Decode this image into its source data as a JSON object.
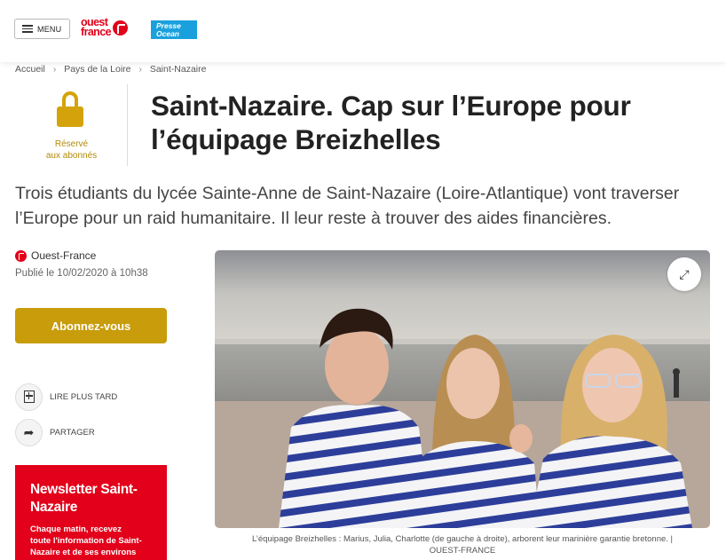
{
  "header": {
    "menu_label": "MENU",
    "brand_main_line1": "ouest",
    "brand_main_line2": "france",
    "brand_partner_line1": "Presse",
    "brand_partner_line2": "Ocean"
  },
  "breadcrumb": [
    "Accueil",
    "Pays de la Loire",
    "Saint-Nazaire"
  ],
  "reserved": {
    "line1": "Réservé",
    "line2": "aux abonnés"
  },
  "article": {
    "title_line1": "Saint-Nazaire. Cap sur l’Europe pour",
    "title_line2": "l’équipage Breizhelles",
    "lead": "Trois étudiants du lycée Sainte-Anne de Saint-Nazaire (Loire-Atlantique) vont traverser l’Europe pour un raid humanitaire. Il leur reste à trouver des aides financières.",
    "source": "Ouest-France",
    "published": "Publié le 10/02/2020 à 10h38",
    "caption_line1": "L’équipage Breizhelles : Marius, Julia, Charlotte (de gauche à droite), arborent leur marinière garantie bretonne. |",
    "caption_line2": "OUEST-FRANCE"
  },
  "actions": {
    "subscribe": "Abonnez-vous",
    "read_later": "LIRE PLUS TARD",
    "share": "PARTAGER"
  },
  "newsletter": {
    "title_line1": "Newsletter Saint-",
    "title_line2": "Nazaire",
    "text_line1": "Chaque matin, recevez",
    "text_line2": "toute l'information de Saint-",
    "text_line3": "Nazaire et de ses environs"
  },
  "colors": {
    "brand_red": "#e2001a",
    "gold": "#c89c0a",
    "partner_blue": "#1aa1dd"
  },
  "icons": [
    "menu-icon",
    "lock-icon",
    "bookmark-icon",
    "share-icon",
    "expand-icon"
  ]
}
